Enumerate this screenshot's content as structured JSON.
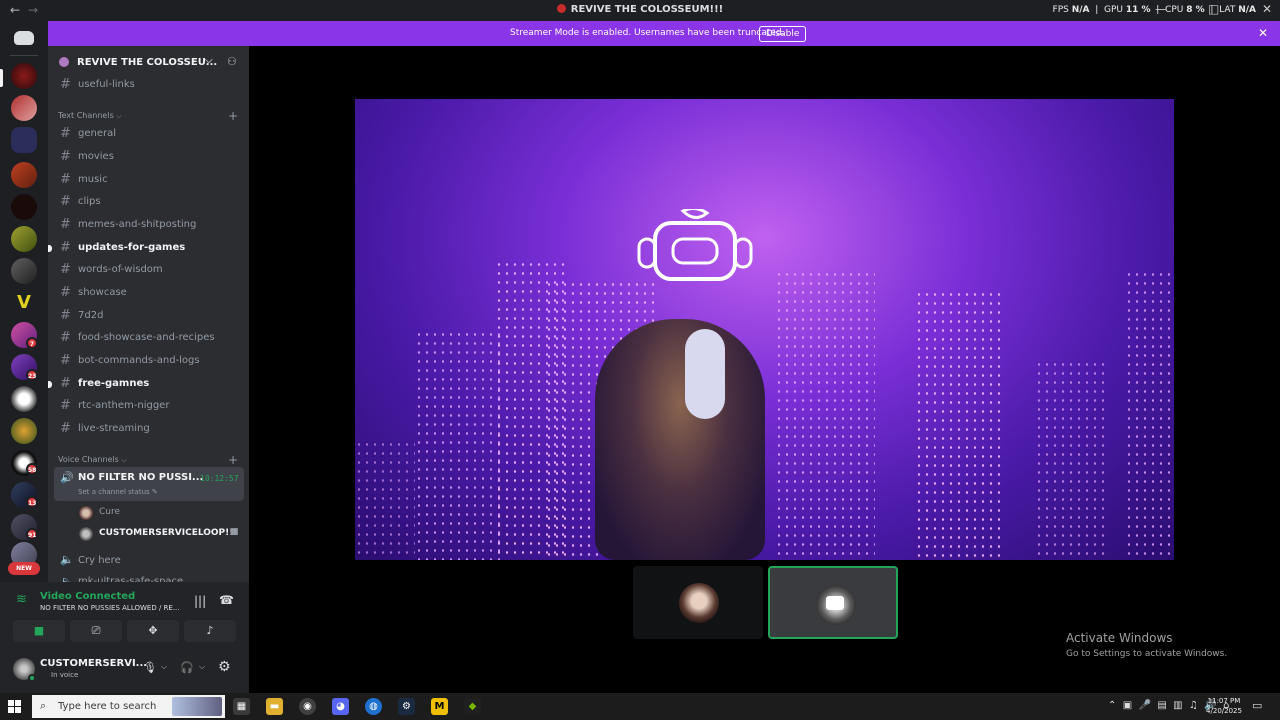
{
  "titlebar": {
    "back_label": "←",
    "forward_label": "→",
    "title": "REVIVE THE COLOSSEUM!!!",
    "stats": {
      "fps_label": "FPS",
      "fps": "N/A",
      "gpu_label": "GPU",
      "gpu": "11 %",
      "cpu_label": "CPU",
      "cpu": "8 %",
      "lat_label": "LAT",
      "lat": "N/A"
    },
    "min_label": "—",
    "max_label": "□",
    "close_label": "✕"
  },
  "banner": {
    "message": "Streamer Mode is enabled. Usernames have been truncated.",
    "disable_label": "Disable",
    "close_label": "✕",
    "color": "#8a35e8"
  },
  "guilds": {
    "home_label": "Discord",
    "badges": [
      "7",
      "23",
      "58",
      "13",
      "91",
      "NEW"
    ],
    "servers": [
      "RTC",
      "server-2",
      "server-3",
      "server-4",
      "SHOT",
      "server-6",
      "server-7",
      "V",
      "server-9",
      "server-10",
      "server-11",
      "server-12",
      "server-13",
      "server-14",
      "server-15",
      "server-16"
    ]
  },
  "server": {
    "name": "REVIVE THE COLOSSEU...",
    "chevron": "⌵",
    "invite_icon": "person-add-icon"
  },
  "channels": {
    "top": {
      "label": "useful-links"
    },
    "text_category": "Text Channels",
    "text": [
      {
        "label": "general",
        "unread": false
      },
      {
        "label": "movies",
        "unread": false
      },
      {
        "label": "music",
        "unread": false
      },
      {
        "label": "clips",
        "unread": false
      },
      {
        "label": "memes-and-shitposting",
        "unread": false
      },
      {
        "label": "updates-for-games",
        "unread": true
      },
      {
        "label": "words-of-wisdom",
        "unread": false
      },
      {
        "label": "showcase",
        "unread": false
      },
      {
        "label": "7d2d",
        "unread": false
      },
      {
        "label": "food-showcase-and-recipes",
        "unread": false
      },
      {
        "label": "bot-commands-and-logs",
        "unread": false
      },
      {
        "label": "free-gamnes",
        "unread": true
      },
      {
        "label": "rtc-anthem-nigger",
        "unread": false
      },
      {
        "label": "live-streaming",
        "unread": false
      }
    ],
    "voice_category": "Voice Channels",
    "voice": {
      "active": {
        "label": "NO FILTER NO PUSSI...",
        "timer": "10:12:57",
        "status": "Set a channel status"
      },
      "members": [
        {
          "name": "Cure"
        },
        {
          "name": "CUSTOMERSERVICELOOP!!!"
        }
      ],
      "others": [
        {
          "label": "Cry here"
        },
        {
          "label": "mk-ultras-safe-space"
        }
      ]
    }
  },
  "voice_panel": {
    "connected": "Video Connected",
    "channel": "NO FILTER NO PUSSIES ALLOWED / RE...",
    "buttons": [
      "camera-icon",
      "screen-share-icon",
      "activities-icon",
      "soundboard-icon"
    ]
  },
  "user_panel": {
    "username": "CUSTOMERSERVI...",
    "status": "In voice",
    "mic_icon": "🎙",
    "headset_icon": "🎧",
    "settings_icon": "⚙"
  },
  "stage": {
    "video_label": "livestream"
  },
  "tiles": [
    {
      "name": "participant-cure"
    },
    {
      "name": "participant-customerserviceloop",
      "active": true
    }
  ],
  "watermark": {
    "line1": "Activate Windows",
    "line2": "Go to Settings to activate Windows."
  },
  "taskbar": {
    "search_placeholder": "Type here to search",
    "apps": [
      "file-explorer",
      "chrome",
      "discord",
      "edge",
      "steam",
      "m-app",
      "nvidia"
    ],
    "time": "11:07 PM",
    "date": "4/20/2025"
  }
}
